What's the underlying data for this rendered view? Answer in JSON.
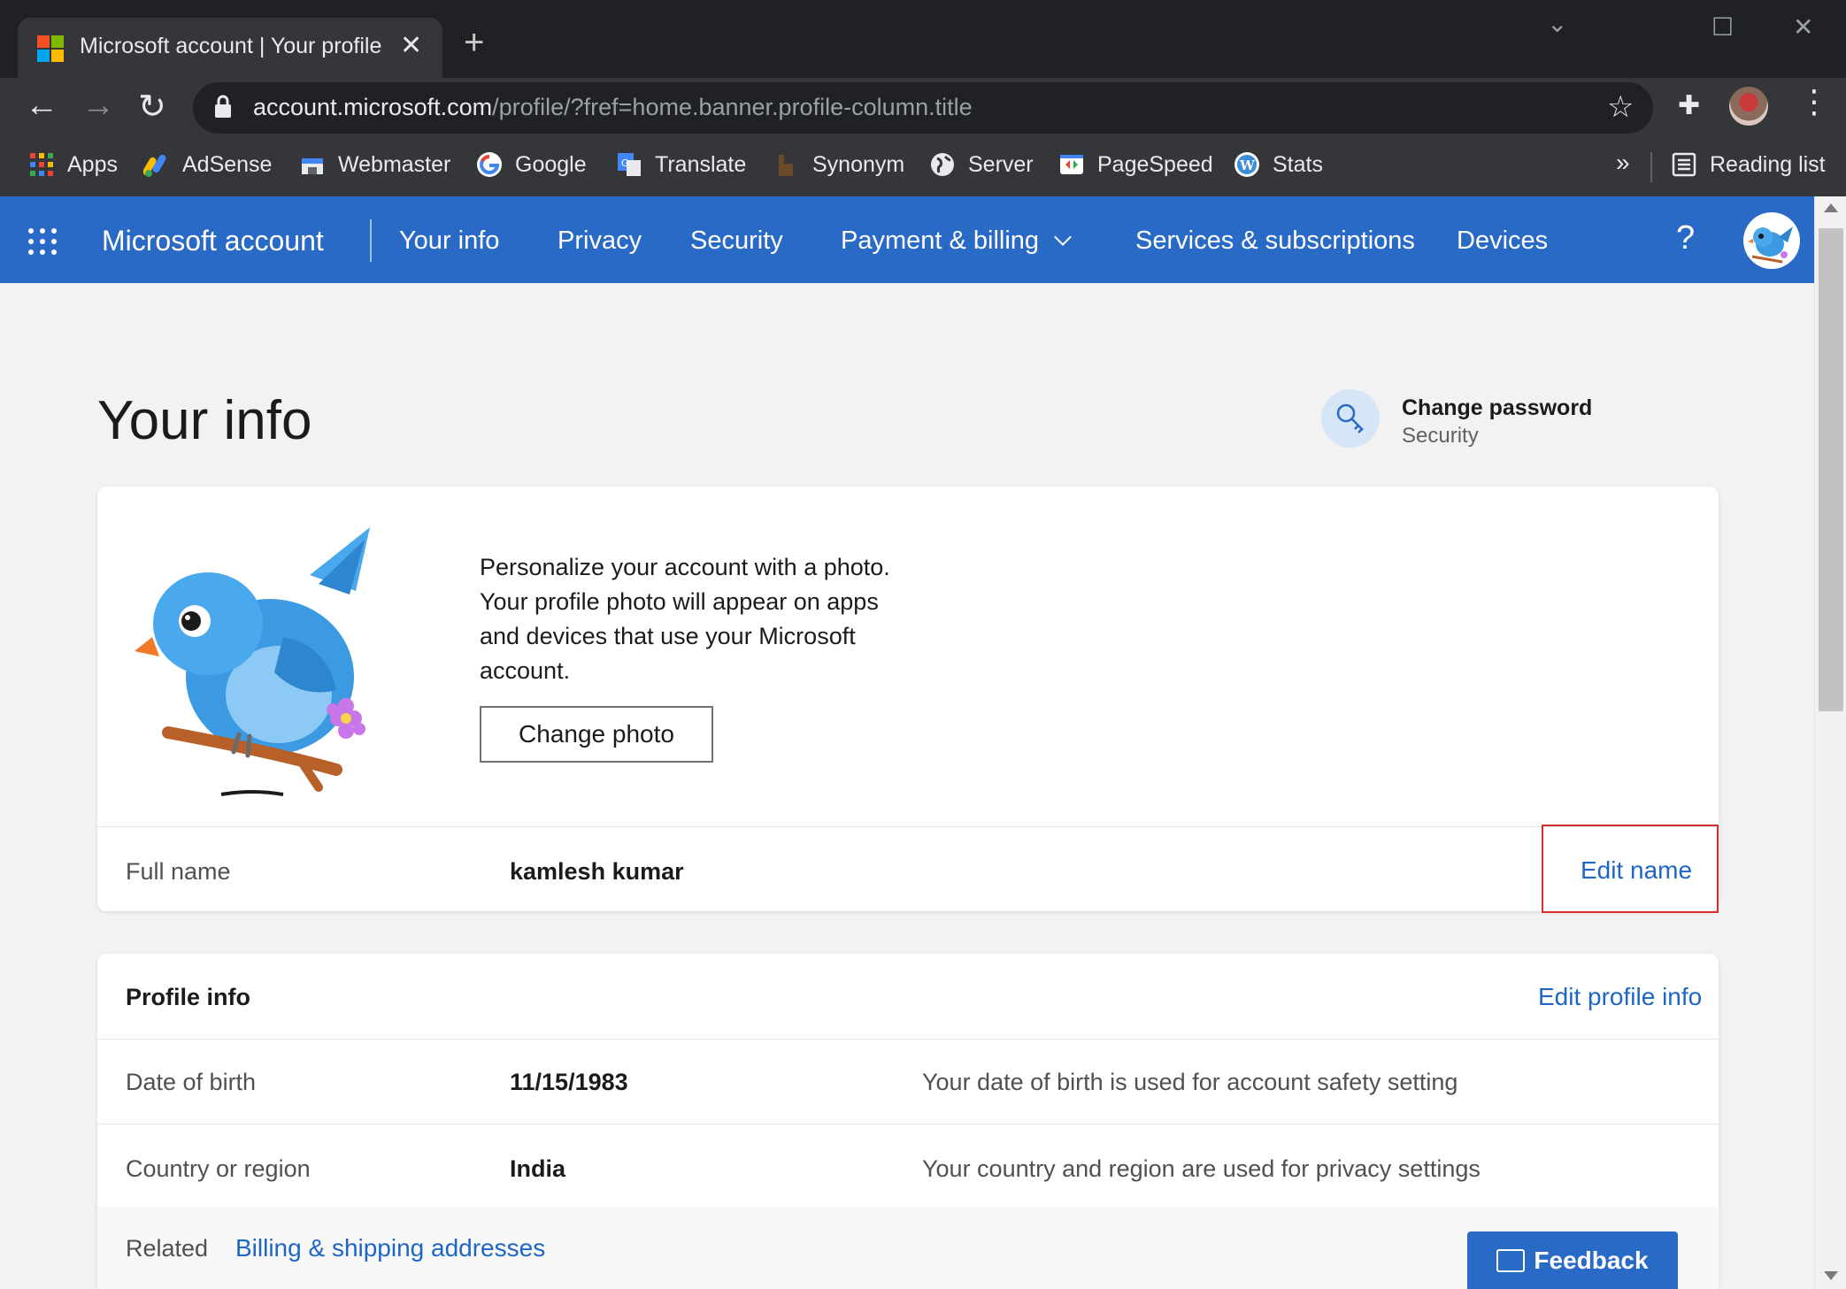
{
  "browser": {
    "tab_title": "Microsoft account | Your profile",
    "tab_close": "✕",
    "new_tab": "+",
    "url_domain": "account.microsoft.com",
    "url_path": "/profile/?fref=home.banner.profile-column.title",
    "bookmarks": [
      "Apps",
      "AdSense",
      "Webmaster",
      "Google",
      "Translate",
      "Synonym",
      "Server",
      "PageSpeed",
      "Stats"
    ],
    "more_bookmarks": "»",
    "reading_list": "Reading list"
  },
  "nav": {
    "brand": "Microsoft account",
    "links": [
      "Your info",
      "Privacy",
      "Security",
      "Payment & billing",
      "Services & subscriptions",
      "Devices"
    ],
    "help": "?"
  },
  "page": {
    "title": "Your info",
    "change_password": {
      "title": "Change password",
      "subtitle": "Security"
    }
  },
  "photo_card": {
    "text": "Personalize your account with a photo. Your profile photo will appear on apps and devices that use your Microsoft account.",
    "button": "Change photo",
    "full_name_label": "Full name",
    "full_name_value": "kamlesh kumar",
    "edit_name": "Edit name"
  },
  "profile_info": {
    "title": "Profile info",
    "edit": "Edit profile info",
    "rows": [
      {
        "label": "Date of birth",
        "value": "11/15/1983",
        "desc": "Your date of birth is used for account safety setting"
      },
      {
        "label": "Country or region",
        "value": "India",
        "desc": "Your country and region are used for privacy settings"
      }
    ],
    "related_label": "Related",
    "related_link": "Billing & shipping addresses"
  },
  "feedback": "Feedback",
  "colors": {
    "accent": "#2a6ac7",
    "link": "#1e66c6",
    "highlight": "#d32f2f"
  }
}
